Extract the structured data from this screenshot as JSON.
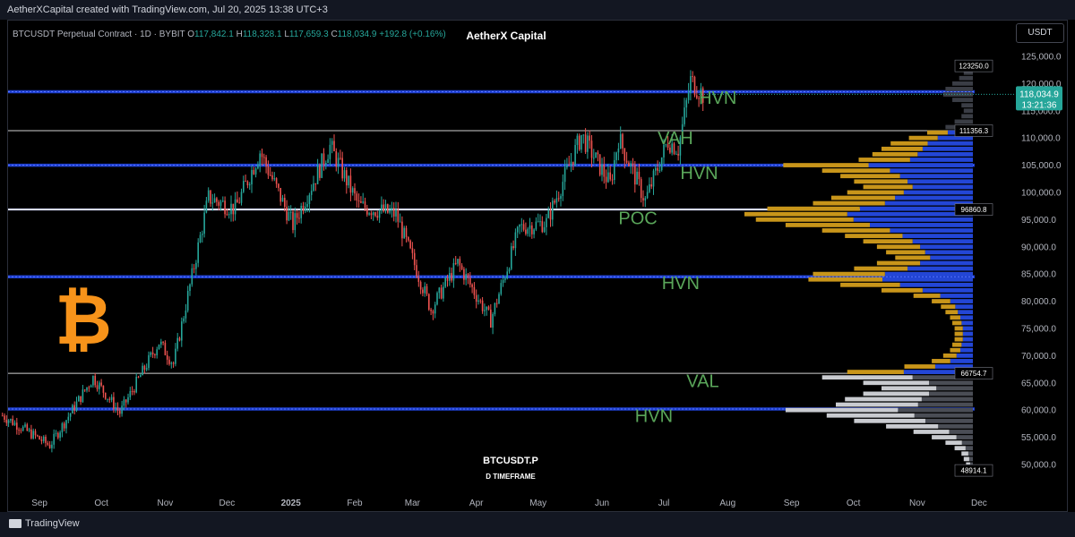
{
  "header": {
    "attribution": "AetherXCapital created with TradingView.com, Jul 20, 2025 13:38 UTC+3"
  },
  "legend": {
    "symbol": "BTCUSDT Perpetual Contract · 1D · BYBIT",
    "o_label": "O",
    "o": "117,842.1",
    "h_label": "H",
    "h": "118,328.1",
    "l_label": "L",
    "l": "117,659.3",
    "c_label": "C",
    "c": "118,034.9",
    "change": "+192.8 (+0.16%)"
  },
  "brand": "AetherX Capital",
  "currency_button": "USDT",
  "footer": {
    "logo_text": "TradingView",
    "ticker": "BTCUSDT.P",
    "timeframe": "D TIMEFRAME"
  },
  "colors": {
    "up": "#26a69a",
    "down": "#ef5350",
    "hvn_line": "#1e3fcf",
    "poc_line": "#d8dcff",
    "profile_gold": "#c8951a",
    "profile_blue": "#2346d6",
    "profile_grey": "#8a8d94",
    "label_green": "#5aa65a",
    "bitcoin": "#f7931a",
    "price_tag": "#26a69a"
  },
  "chart_data": {
    "type": "candlestick",
    "series": [
      {
        "name": "BTCUSDT.P",
        "values": []
      }
    ],
    "ylim": [
      47000,
      127000
    ],
    "y_ticks": [
      "125,000.0",
      "120,000.0",
      "115,000.0",
      "110,000.0",
      "105,000.0",
      "100,000.0",
      "95,000.0",
      "90,000.0",
      "85,000.0",
      "80,000.0",
      "75,000.0",
      "70,000.0",
      "65,000.0",
      "60,000.0",
      "55,000.0",
      "50,000.0"
    ],
    "y_tick_values": [
      125000,
      120000,
      115000,
      110000,
      105000,
      100000,
      95000,
      90000,
      85000,
      80000,
      75000,
      70000,
      65000,
      60000,
      55000,
      50000
    ],
    "x_ticks": [
      "Sep",
      "Oct",
      "Nov",
      "Dec",
      "2025",
      "Feb",
      "Mar",
      "Apr",
      "May",
      "Jun",
      "Jul",
      "Aug",
      "Sep",
      "Oct",
      "Nov",
      "Dec"
    ],
    "x_tick_dates": [
      "2024-09-01",
      "2024-10-01",
      "2024-11-01",
      "2024-12-01",
      "2025-01-01",
      "2025-02-01",
      "2025-03-01",
      "2025-04-01",
      "2025-05-01",
      "2025-06-01",
      "2025-07-01",
      "2025-08-01",
      "2025-09-01",
      "2025-10-01",
      "2025-11-01",
      "2025-12-01"
    ],
    "last_price": "118,034.9",
    "countdown": "13:21:36",
    "last_price_value": 118034.9,
    "anchors": [
      [
        "2024-08-14",
        59000
      ],
      [
        "2024-09-06",
        53500
      ],
      [
        "2024-09-27",
        66000
      ],
      [
        "2024-10-10",
        59500
      ],
      [
        "2024-10-29",
        72500
      ],
      [
        "2024-11-05",
        68500
      ],
      [
        "2024-11-22",
        99000
      ],
      [
        "2024-12-05",
        97000
      ],
      [
        "2024-12-17",
        107500
      ],
      [
        "2025-01-02",
        94000
      ],
      [
        "2025-01-20",
        108500
      ],
      [
        "2025-02-03",
        97500
      ],
      [
        "2025-02-21",
        96000
      ],
      [
        "2025-03-10",
        78500
      ],
      [
        "2025-03-23",
        87000
      ],
      [
        "2025-04-08",
        76500
      ],
      [
        "2025-04-22",
        93500
      ],
      [
        "2025-05-05",
        94500
      ],
      [
        "2025-05-22",
        110500
      ],
      [
        "2025-06-05",
        101500
      ],
      [
        "2025-06-09",
        110000
      ],
      [
        "2025-06-22",
        98500
      ],
      [
        "2025-07-03",
        109500
      ],
      [
        "2025-07-08",
        108000
      ],
      [
        "2025-07-14",
        120500
      ],
      [
        "2025-07-20",
        118034.9
      ]
    ],
    "levels": [
      {
        "value": 118500,
        "kind": "hvn"
      },
      {
        "value": 111356.3,
        "kind": "white",
        "tag": "111356.3"
      },
      {
        "value": 105000,
        "kind": "hvn"
      },
      {
        "value": 96860.8,
        "kind": "poc",
        "tag": "96860.8"
      },
      {
        "value": 84500,
        "kind": "hvn"
      },
      {
        "value": 66754.7,
        "kind": "white",
        "tag": "66754.7"
      },
      {
        "value": 60200,
        "kind": "hvn"
      }
    ],
    "range_tags": [
      {
        "value": 123250,
        "text": "123250.0"
      },
      {
        "value": 48914.1,
        "text": "48914.1"
      }
    ],
    "zone_labels": [
      {
        "text": "HVN",
        "x_date": "2025-07-18",
        "value": 116300
      },
      {
        "text": "VAH",
        "x_date": "2025-06-28",
        "value": 108900
      },
      {
        "text": "HVN",
        "x_date": "2025-07-09",
        "value": 102500
      },
      {
        "text": "POC",
        "x_date": "2025-06-09",
        "value": 94200
      },
      {
        "text": "HVN",
        "x_date": "2025-06-30",
        "value": 82200
      },
      {
        "text": "VAL",
        "x_date": "2025-07-12",
        "value": 64200
      },
      {
        "text": "HVN",
        "x_date": "2025-06-17",
        "value": 57800
      }
    ],
    "volume_profile": [
      [
        123000,
        0.03
      ],
      [
        122000,
        0.04
      ],
      [
        121000,
        0.06
      ],
      [
        120000,
        0.09
      ],
      [
        119000,
        0.12
      ],
      [
        118000,
        0.13
      ],
      [
        117000,
        0.09
      ],
      [
        116000,
        0.05
      ],
      [
        115000,
        0.04
      ],
      [
        114000,
        0.05
      ],
      [
        113000,
        0.08
      ],
      [
        112000,
        0.12
      ],
      [
        111000,
        0.2
      ],
      [
        110000,
        0.28
      ],
      [
        109000,
        0.36
      ],
      [
        108000,
        0.4
      ],
      [
        107000,
        0.44
      ],
      [
        106000,
        0.5
      ],
      [
        105000,
        0.83
      ],
      [
        104000,
        0.66
      ],
      [
        103000,
        0.58
      ],
      [
        102000,
        0.52
      ],
      [
        101000,
        0.48
      ],
      [
        100000,
        0.55
      ],
      [
        99000,
        0.62
      ],
      [
        98000,
        0.7
      ],
      [
        97000,
        0.9
      ],
      [
        96000,
        1.0
      ],
      [
        95000,
        0.95
      ],
      [
        94000,
        0.82
      ],
      [
        93000,
        0.66
      ],
      [
        92000,
        0.56
      ],
      [
        91000,
        0.48
      ],
      [
        90000,
        0.42
      ],
      [
        89000,
        0.38
      ],
      [
        88000,
        0.34
      ],
      [
        87000,
        0.42
      ],
      [
        86000,
        0.52
      ],
      [
        85000,
        0.7
      ],
      [
        84000,
        0.72
      ],
      [
        83000,
        0.58
      ],
      [
        82000,
        0.4
      ],
      [
        81000,
        0.26
      ],
      [
        80000,
        0.18
      ],
      [
        79000,
        0.14
      ],
      [
        78000,
        0.12
      ],
      [
        77000,
        0.1
      ],
      [
        76000,
        0.09
      ],
      [
        75000,
        0.08
      ],
      [
        74000,
        0.08
      ],
      [
        73000,
        0.08
      ],
      [
        72000,
        0.09
      ],
      [
        71000,
        0.1
      ],
      [
        70000,
        0.13
      ],
      [
        69000,
        0.18
      ],
      [
        68000,
        0.3
      ],
      [
        67000,
        0.55
      ],
      [
        66000,
        0.66
      ],
      [
        65000,
        0.48
      ],
      [
        64000,
        0.4
      ],
      [
        63000,
        0.48
      ],
      [
        62000,
        0.56
      ],
      [
        61000,
        0.6
      ],
      [
        60000,
        0.82
      ],
      [
        59000,
        0.64
      ],
      [
        58000,
        0.52
      ],
      [
        57000,
        0.38
      ],
      [
        56000,
        0.26
      ],
      [
        55000,
        0.18
      ],
      [
        54000,
        0.12
      ],
      [
        53000,
        0.08
      ],
      [
        52000,
        0.05
      ],
      [
        51000,
        0.04
      ],
      [
        50000,
        0.03
      ],
      [
        49000,
        0.02
      ]
    ]
  }
}
